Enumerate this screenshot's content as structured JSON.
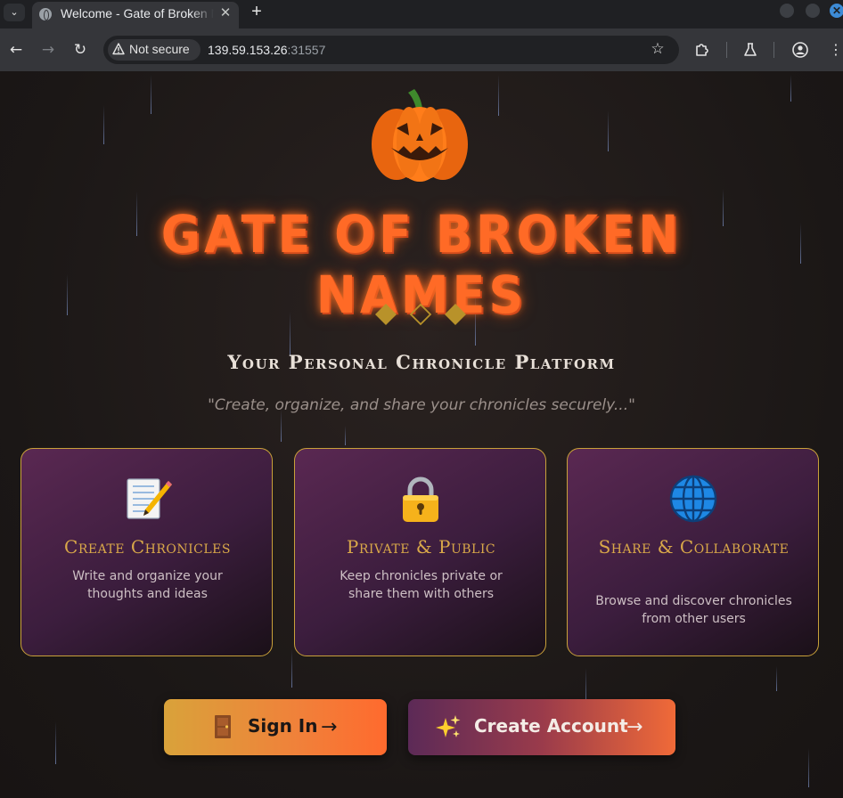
{
  "browser": {
    "tab_title": "Welcome - Gate of Broken Names",
    "tab_close": "✕",
    "new_tab": "+",
    "security_label": "Not secure",
    "url_host": "139.59.153.26",
    "url_port": ":31557",
    "close_window": "✕"
  },
  "page": {
    "title": "Gate of Broken Names",
    "tagline": "Your Personal Chronicle Platform",
    "quote": "\"Create, organize, and share your chronicles securely...\"",
    "features": [
      {
        "icon": "memo-icon",
        "title": "Create Chronicles",
        "description": "Write and organize your thoughts and ideas"
      },
      {
        "icon": "lock-icon",
        "title": "Private & Public",
        "description": "Keep chronicles private or share them with others"
      },
      {
        "icon": "globe-icon",
        "title": "Share & Collaborate",
        "description": "Browse and discover chronicles from other users"
      }
    ],
    "buttons": {
      "sign_in": {
        "icon": "door-icon",
        "label": "Sign In",
        "arrow": "→"
      },
      "create_account": {
        "icon": "sparkles-icon",
        "label": "Create Account",
        "arrow": "→"
      }
    }
  },
  "colors": {
    "title_orange": "#ff6a26",
    "card_border_gold": "#c9a13a",
    "card_title_gold": "#d9a849",
    "background": "#1b1716"
  }
}
